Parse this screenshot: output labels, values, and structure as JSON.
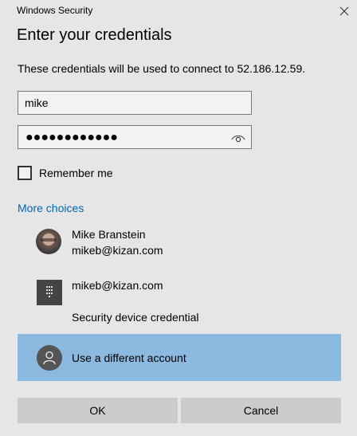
{
  "window": {
    "title": "Windows Security",
    "close_icon": "close-icon"
  },
  "heading": "Enter your credentials",
  "description": "These credentials will be used to connect to 52.186.12.59.",
  "username": {
    "value": "mike"
  },
  "password": {
    "masked_value": "●●●●●●●●●●●●",
    "reveal_icon": "eye-icon"
  },
  "remember": {
    "label": "Remember me",
    "checked": false
  },
  "more_choices": "More choices",
  "accounts": [
    {
      "name": "Mike Branstein",
      "email": "mikeb@kizan.com",
      "icon": "user-photo-avatar"
    },
    {
      "email": "mikeb@kizan.com",
      "subtitle": "Security device credential",
      "icon": "security-device-icon"
    },
    {
      "label": "Use a different account",
      "icon": "generic-user-icon",
      "selected": true
    }
  ],
  "buttons": {
    "ok": "OK",
    "cancel": "Cancel"
  },
  "colors": {
    "background": "#e6e6e6",
    "link": "#0067b8",
    "selected": "#8cb9e0",
    "button": "#cccccc"
  }
}
